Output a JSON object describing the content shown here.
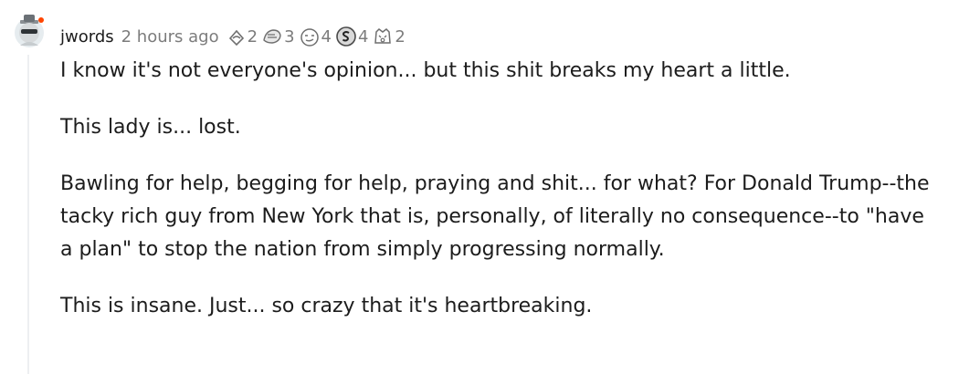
{
  "comment": {
    "username": "jwords",
    "timestamp": "2 hours ago",
    "awards": [
      {
        "icon": "heart-hands-award-icon",
        "count": "2"
      },
      {
        "icon": "wholesome-seal-award-icon",
        "count": "3"
      },
      {
        "icon": "facepalm-award-icon",
        "count": "4"
      },
      {
        "icon": "coin-s-award-icon",
        "count": "4"
      },
      {
        "icon": "surprised-face-award-icon",
        "count": "2"
      }
    ],
    "paragraphs": [
      "I know it's not everyone's opinion... but this shit breaks my heart a little.",
      "This lady is... lost.",
      "Bawling for help, begging for help, praying and shit... for what? For Donald Trump--the tacky rich guy from New York that is, personally, of literally no consequence--to \"have a plan\" to stop the nation from simply progressing normally.",
      "This is insane. Just... so crazy that it's heartbreaking."
    ]
  }
}
